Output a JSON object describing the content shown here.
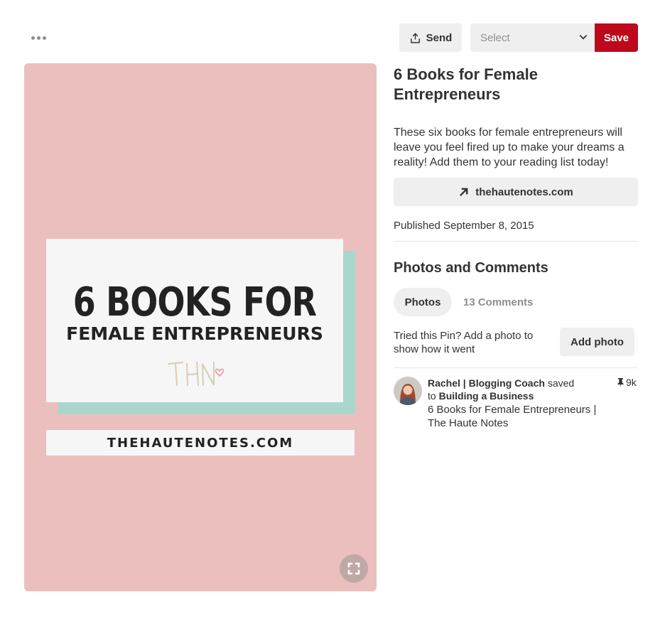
{
  "toolbar": {
    "more_icon": "ellipsis-icon",
    "send_label": "Send",
    "send_icon": "share-upload-icon",
    "board_select_placeholder": "Select",
    "save_label": "Save",
    "save_color": "#bd081c"
  },
  "pin_image": {
    "background_color": "#ebbfbd",
    "accent_color": "#a9d7cb",
    "headline": "6 BOOKS FOR",
    "subheadline": "FEMALE ENTREPRENEURS",
    "logo_text": "THN",
    "url_text": "THEHAUTENOTES.COM",
    "expand_icon": "expand-fullscreen-icon"
  },
  "pin": {
    "title": "6 Books for Female Entrepreneurs",
    "description": "These six books for female entrepreneurs will leave you feel fired up to make your dreams a reality! Add them to your reading list today!",
    "link_label": "thehautenotes.com",
    "link_icon": "arrow-up-right-icon",
    "published": "Published September 8, 2015"
  },
  "comments_section": {
    "title": "Photos and Comments",
    "tabs": [
      {
        "label": "Photos",
        "active": true
      },
      {
        "label": "13 Comments",
        "active": false
      }
    ],
    "tried_prompt": "Tried this Pin? Add a photo to show how it went",
    "add_photo_label": "Add photo"
  },
  "activity": {
    "user_name": "Rachel | Blogging Coach",
    "saved_text": "saved",
    "to_text": "to",
    "board_name": "Building a Business",
    "pin_title": "6 Books for Female Entrepreneurs | The Haute Notes",
    "repin_count": "9k",
    "repin_icon": "pushpin-icon"
  }
}
